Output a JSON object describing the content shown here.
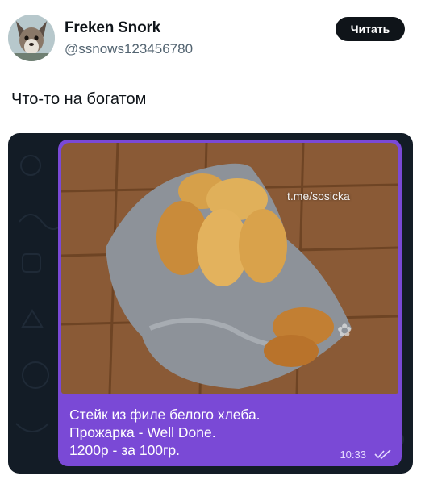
{
  "author": {
    "display_name": "Freken Snork",
    "handle": "@ssnows123456780"
  },
  "follow_button": {
    "label": "Читать"
  },
  "tweet": {
    "text": "Что-то на богатом"
  },
  "media": {
    "photo_watermark": "t.me/sosicka",
    "caption_lines": [
      "Стейк из филе белого хлеба.",
      "Прожарка - Well Done.",
      "1200р - за 100гр."
    ],
    "time": "10:33"
  },
  "colors": {
    "bubble": "#7a49d6",
    "chat_background": "#131c26",
    "follow_button": "#0f1419"
  }
}
